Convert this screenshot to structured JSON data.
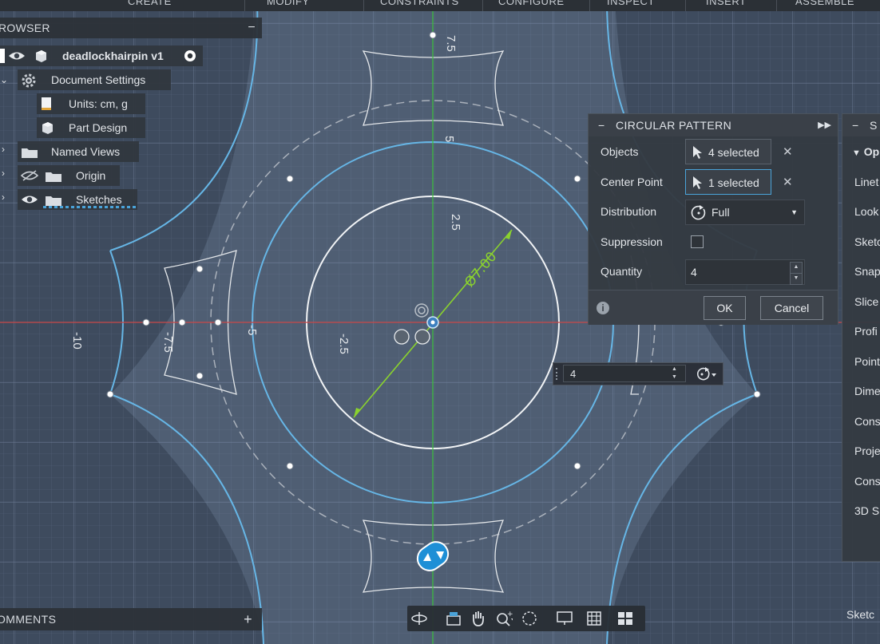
{
  "toolbar": {
    "groups": [
      "CREATE",
      "MODIFY",
      "CONSTRAINTS",
      "CONFIGURE",
      "INSPECT",
      "INSERT",
      "ASSEMBLE"
    ]
  },
  "browser": {
    "title": "ROWSER",
    "collapse_label": "−",
    "root_label": "deadlockhairpin v1",
    "items": [
      {
        "label": "Document Settings"
      },
      {
        "label": "Units: cm, g"
      },
      {
        "label": "Part Design"
      },
      {
        "label": "Named Views"
      },
      {
        "label": "Origin"
      },
      {
        "label": "Sketches"
      }
    ]
  },
  "comments": {
    "title": "OMMENTS",
    "add_label": "+"
  },
  "canvas": {
    "dimension_labels": [
      "7.5",
      "5",
      "2.5",
      "-2.5",
      "-5",
      "-7.5",
      "-10"
    ],
    "diameter_label": "Ø7.00"
  },
  "quantity_float": {
    "value": "4"
  },
  "dialog": {
    "title": "CIRCULAR PATTERN",
    "rows": {
      "objects_label": "Objects",
      "objects_value": "4 selected",
      "center_label": "Center Point",
      "center_value": "1 selected",
      "distribution_label": "Distribution",
      "distribution_value": "Full",
      "suppression_label": "Suppression",
      "quantity_label": "Quantity",
      "quantity_value": "4"
    },
    "clear_glyph": "✕",
    "ok_label": "OK",
    "cancel_label": "Cancel"
  },
  "palette": {
    "title": "S",
    "section": "Op",
    "items": [
      "Linet",
      "Look",
      "Sketc",
      "Snap",
      "Slice",
      "Profi",
      "Point",
      "Dime",
      "Cons",
      "Proje",
      "Cons",
      "3D S"
    ]
  },
  "status": {
    "right_label": "Sketc"
  },
  "colors": {
    "sketch_blue": "#66b6e6",
    "axis_green": "#3ec23e",
    "axis_red": "#c84545",
    "selection_blue": "#1e8fd6"
  }
}
